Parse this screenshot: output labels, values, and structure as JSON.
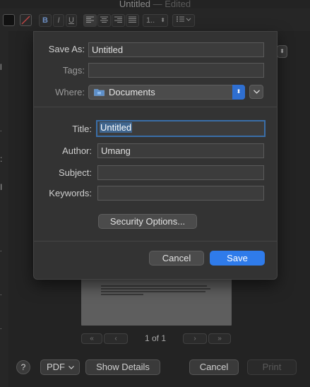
{
  "window": {
    "title": "Untitled",
    "title_suffix": "— Edited"
  },
  "toolbar": {
    "bold_label": "B",
    "italic_label": "I",
    "underline_label": "U",
    "spacing_label": "1.."
  },
  "save_sheet": {
    "save_as_label": "Save As:",
    "save_as_value": "Untitled",
    "tags_label": "Tags:",
    "tags_value": "",
    "where_label": "Where:",
    "where_value": "Documents",
    "title_label": "Title:",
    "title_value": "Untitled",
    "author_label": "Author:",
    "author_value": "Umang",
    "subject_label": "Subject:",
    "subject_value": "",
    "keywords_label": "Keywords:",
    "keywords_value": "",
    "security_button": "Security Options...",
    "cancel_button": "Cancel",
    "save_button": "Save",
    "accent_color": "#2f7bea"
  },
  "print_panel": {
    "page_count": "1 of 1",
    "help_label": "?",
    "pdf_label": "PDF",
    "show_details_label": "Show Details",
    "cancel_label": "Cancel",
    "print_label": "Print"
  },
  "icons": [
    "folder-icon",
    "chevron-updown-icon",
    "chevron-down-icon",
    "align-left-icon",
    "align-center-icon",
    "align-right-icon",
    "justify-icon",
    "list-icon",
    "help-icon"
  ]
}
